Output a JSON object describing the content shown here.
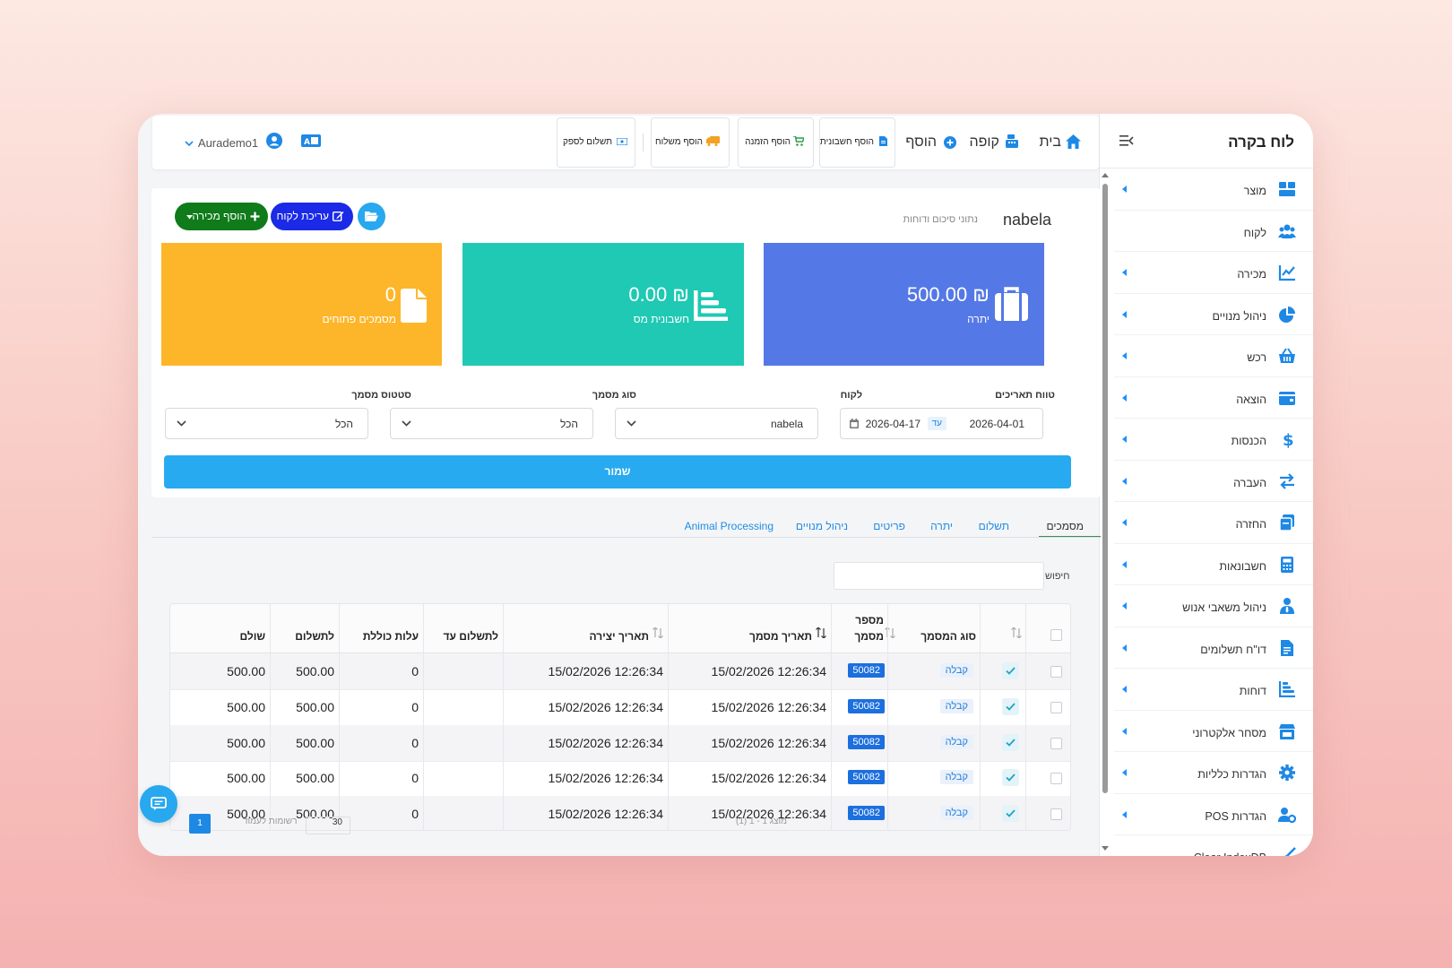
{
  "sidebar": {
    "title": "לוח בקרה",
    "items": [
      {
        "label": "מוצר",
        "icon": "boxes-icon",
        "caret": true
      },
      {
        "label": "לקוח",
        "icon": "users-icon",
        "caret": false
      },
      {
        "label": "מכירה",
        "icon": "line-chart-icon",
        "caret": true
      },
      {
        "label": "ניהול מנויים",
        "icon": "pie-chart-icon",
        "caret": true
      },
      {
        "label": "רכש",
        "icon": "basket-icon",
        "caret": true
      },
      {
        "label": "הוצאה",
        "icon": "wallet-icon",
        "caret": true
      },
      {
        "label": "הכנסות",
        "icon": "dollar-icon",
        "caret": true
      },
      {
        "label": "העברה",
        "icon": "transfer-icon",
        "caret": true
      },
      {
        "label": "החזרה",
        "icon": "return-icon",
        "caret": true
      },
      {
        "label": "חשבונאות",
        "icon": "calculator-icon",
        "caret": true
      },
      {
        "label": "ניהול משאבי אנוש",
        "icon": "user-tie-icon",
        "caret": true
      },
      {
        "label": "דו\"ח תשלומים",
        "icon": "file-invoice-icon",
        "caret": true
      },
      {
        "label": "דוחות",
        "icon": "bar-chart-icon",
        "caret": true
      },
      {
        "label": "מסחר אלקטרוני",
        "icon": "store-icon",
        "caret": true
      },
      {
        "label": "הגדרות כלליות",
        "icon": "gear-icon",
        "caret": true
      },
      {
        "label": "POS הגדרות",
        "icon": "user-gear-icon",
        "caret": true
      },
      {
        "label": "Clear IndexDB",
        "icon": "broom-icon",
        "caret": false
      }
    ]
  },
  "topbar": {
    "nav": {
      "home": "בית",
      "pos": "קופה",
      "add": "הוסף"
    },
    "quick": {
      "invoice": "הוסף חשבונית",
      "order": "הוסף הזמנה",
      "shipment": "הוסף משלוח",
      "supplier_payment": "תשלום לספק"
    },
    "user": "Aurademo1"
  },
  "customer": {
    "name": "nabela",
    "subtitle": "נתוני סיכום ודוחות",
    "edit_button": "עריכת לקוח",
    "add_sale_button": "הוסף מכירה"
  },
  "stats": [
    {
      "value": "500.00 ₪",
      "label": "יתרה",
      "color": "#5478e6"
    },
    {
      "value": "0.00 ₪",
      "label": "חשבונית מס",
      "color": "#20c9b3"
    },
    {
      "value": "0",
      "label": "מסמכים פתוחים",
      "color": "#fdb62a"
    }
  ],
  "filters": {
    "date_range_label": "טווח תאריכים",
    "date_from": "2026-04-01",
    "date_to_word": "עד",
    "date_to": "2026-04-17",
    "customer_label": "לקוח",
    "customer_value": "nabela",
    "doc_type_label": "סוג מסמך",
    "doc_type_value": "הכל",
    "doc_status_label": "סטטוס מסמך",
    "doc_status_value": "הכל",
    "save": "שמור"
  },
  "tabs": [
    "מסמכים",
    "תשלום",
    "יתרה",
    "פריטים",
    "ניהול מנויים",
    "Animal Processing"
  ],
  "search_label": "חיפוש",
  "table": {
    "headers": {
      "type": "סוג המסמך",
      "number_1": "מספר",
      "number_2": "מסמך",
      "doc_date": "תאריך מסמך",
      "created": "תאריך יצירה",
      "due": "לתשלום עד",
      "total_cost": "עלות כוללת",
      "to_pay": "לתשלום",
      "paid": "שולם"
    },
    "rows": [
      {
        "type": "קבלה",
        "number": "50082",
        "doc_date": "15/02/2026 12:26:34",
        "created": "15/02/2026 12:26:34",
        "due": "",
        "total_cost": "0",
        "to_pay": "500.00",
        "paid": "500.00"
      },
      {
        "type": "קבלה",
        "number": "50082",
        "doc_date": "15/02/2026 12:26:34",
        "created": "15/02/2026 12:26:34",
        "due": "",
        "total_cost": "0",
        "to_pay": "500.00",
        "paid": "500.00"
      },
      {
        "type": "קבלה",
        "number": "50082",
        "doc_date": "15/02/2026 12:26:34",
        "created": "15/02/2026 12:26:34",
        "due": "",
        "total_cost": "0",
        "to_pay": "500.00",
        "paid": "500.00"
      },
      {
        "type": "קבלה",
        "number": "50082",
        "doc_date": "15/02/2026 12:26:34",
        "created": "15/02/2026 12:26:34",
        "due": "",
        "total_cost": "0",
        "to_pay": "500.00",
        "paid": "500.00"
      },
      {
        "type": "קבלה",
        "number": "50082",
        "doc_date": "15/02/2026 12:26:34",
        "created": "15/02/2026 12:26:34",
        "due": "",
        "total_cost": "0",
        "to_pay": "500.00",
        "paid": "500.00"
      }
    ]
  },
  "pager": {
    "summary": "(1) 1 - 1 מוצג",
    "per_page_label": "רשומות לעמוד",
    "per_page": "30",
    "page": "1"
  }
}
